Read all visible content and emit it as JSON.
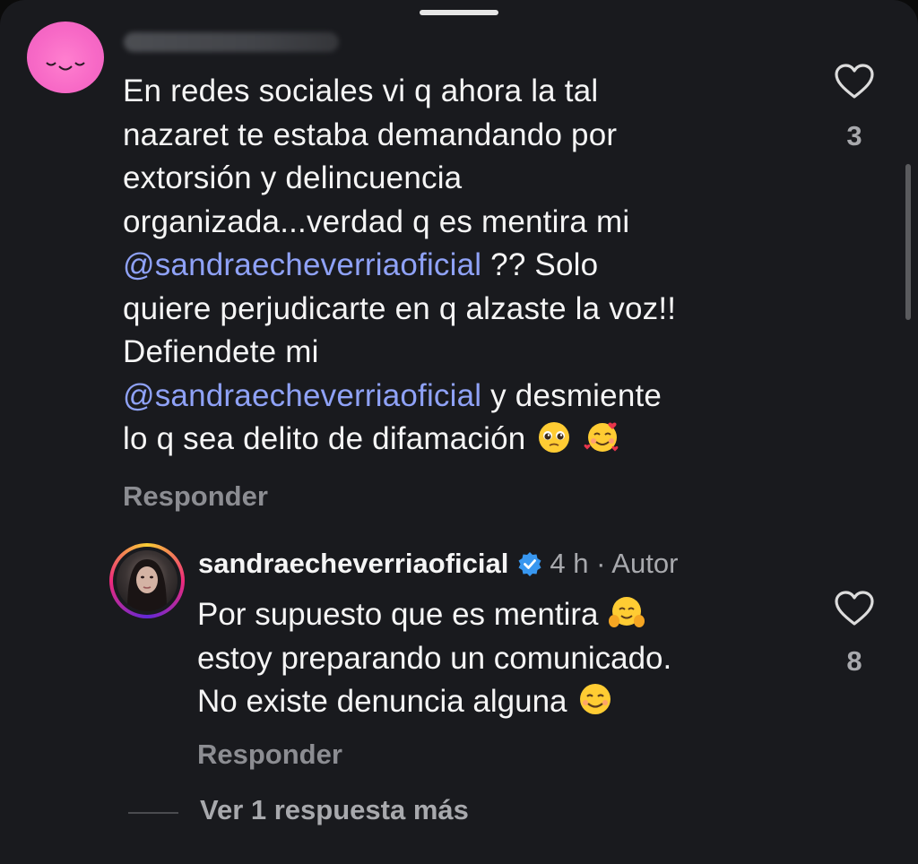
{
  "comment": {
    "username_blurred": true,
    "lines": [
      {
        "segments": [
          {
            "text": "En redes sociales vi q ahora la tal"
          }
        ]
      },
      {
        "segments": [
          {
            "text": "nazaret te estaba demandando por"
          }
        ]
      },
      {
        "segments": [
          {
            "text": "extorsión y delincuencia"
          }
        ]
      },
      {
        "segments": [
          {
            "text": "organizada...verdad q es mentira mi"
          }
        ]
      },
      {
        "segments": [
          {
            "text": "@sandraecheverriaoficial",
            "mention": true
          },
          {
            "text": " ?? Solo"
          }
        ]
      },
      {
        "segments": [
          {
            "text": "quiere perjudicarte en q alzaste la voz!!"
          }
        ]
      },
      {
        "segments": [
          {
            "text": "Defiendete mi"
          }
        ]
      },
      {
        "segments": [
          {
            "text": "@sandraecheverriaoficial",
            "mention": true
          },
          {
            "text": " y desmiente"
          }
        ]
      },
      {
        "segments": [
          {
            "text": "lo q sea delito de difamación "
          },
          {
            "emoji": "pleading-face-emoji"
          },
          {
            "text": " "
          },
          {
            "emoji": "smiling-face-with-hearts-emoji"
          }
        ]
      }
    ],
    "reply_label": "Responder",
    "likes": "3",
    "like_icon": "heart-outline-icon"
  },
  "reply": {
    "username": "sandraecheverriaoficial",
    "verified_icon": "verified-badge-icon",
    "meta": "4 h · Autor",
    "lines": [
      {
        "segments": [
          {
            "text": "Por supuesto que es mentira "
          },
          {
            "emoji": "hugging-face-emoji"
          }
        ]
      },
      {
        "segments": [
          {
            "text": "estoy preparando un comunicado."
          }
        ]
      },
      {
        "segments": [
          {
            "text": "No existe denuncia alguna "
          },
          {
            "emoji": "smiling-face-emoji"
          }
        ]
      }
    ],
    "reply_label": "Responder",
    "likes": "8",
    "like_icon": "heart-outline-icon"
  },
  "view_more": "Ver 1 respuesta más",
  "colors": {
    "background": "#191a1e",
    "text": "#f5f5f5",
    "secondary_text": "#a8a9ad",
    "mention": "#8fa2f7",
    "verified": "#3897f0"
  }
}
